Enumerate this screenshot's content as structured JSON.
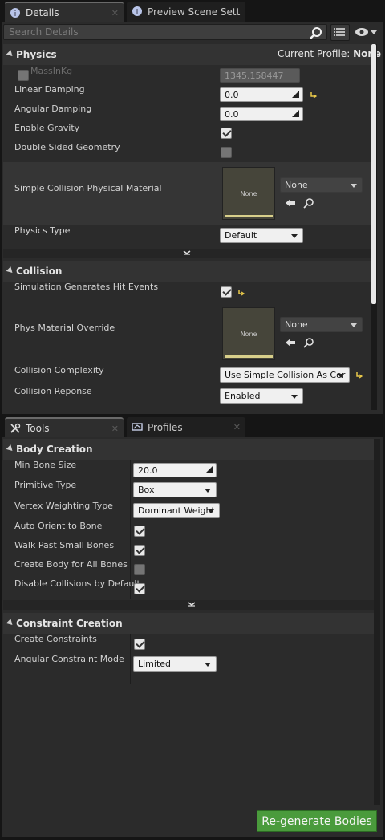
{
  "top_tabs": [
    {
      "label": "Details",
      "icon": "info-icon",
      "active": true
    },
    {
      "label": "Preview Scene Sett",
      "icon": "info-icon",
      "active": false
    }
  ],
  "search": {
    "placeholder": "Search Details"
  },
  "physics": {
    "header": "Physics",
    "profile_label": "Current Profile:",
    "profile_value": "None",
    "mass_label": "MassInKg",
    "mass_value": "1345.158447",
    "linear_damping_label": "Linear Damping",
    "linear_damping_value": "0.0",
    "angular_damping_label": "Angular Damping",
    "angular_damping_value": "0.0",
    "gravity_label": "Enable Gravity",
    "double_sided_label": "Double Sided Geometry",
    "simple_coll_label": "Simple Collision Physical Material",
    "simple_coll_thumb": "None",
    "simple_coll_combo": "None",
    "physics_type_label": "Physics Type",
    "physics_type_value": "Default"
  },
  "collision": {
    "header": "Collision",
    "sim_hit_label": "Simulation Generates Hit Events",
    "phys_mat_label": "Phys Material Override",
    "phys_mat_thumb": "None",
    "phys_mat_combo": "None",
    "complexity_label": "Collision Complexity",
    "complexity_value": "Use Simple Collision As Cor",
    "response_label": "Collision Reponse",
    "response_value": "Enabled"
  },
  "bottom_tabs": [
    {
      "label": "Tools",
      "icon": "tools-icon"
    },
    {
      "label": "Profiles",
      "icon": "profiles-icon"
    }
  ],
  "body_creation": {
    "header": "Body Creation",
    "min_bone_label": "Min Bone Size",
    "min_bone_value": "20.0",
    "primitive_label": "Primitive Type",
    "primitive_value": "Box",
    "vertex_label": "Vertex Weighting Type",
    "vertex_value": "Dominant Weight",
    "auto_orient_label": "Auto Orient to Bone",
    "walk_past_label": "Walk Past Small Bones",
    "create_all_label": "Create Body for All Bones",
    "disable_coll_label": "Disable Collisions by Default"
  },
  "constraint_creation": {
    "header": "Constraint Creation",
    "create_constraints_label": "Create Constraints",
    "angular_mode_label": "Angular Constraint Mode",
    "angular_mode_value": "Limited"
  },
  "regen_button": "Re-generate Bodies",
  "colors": {
    "accent_green": "#4a9b3c",
    "reset_arrow": "#e8c84a"
  }
}
